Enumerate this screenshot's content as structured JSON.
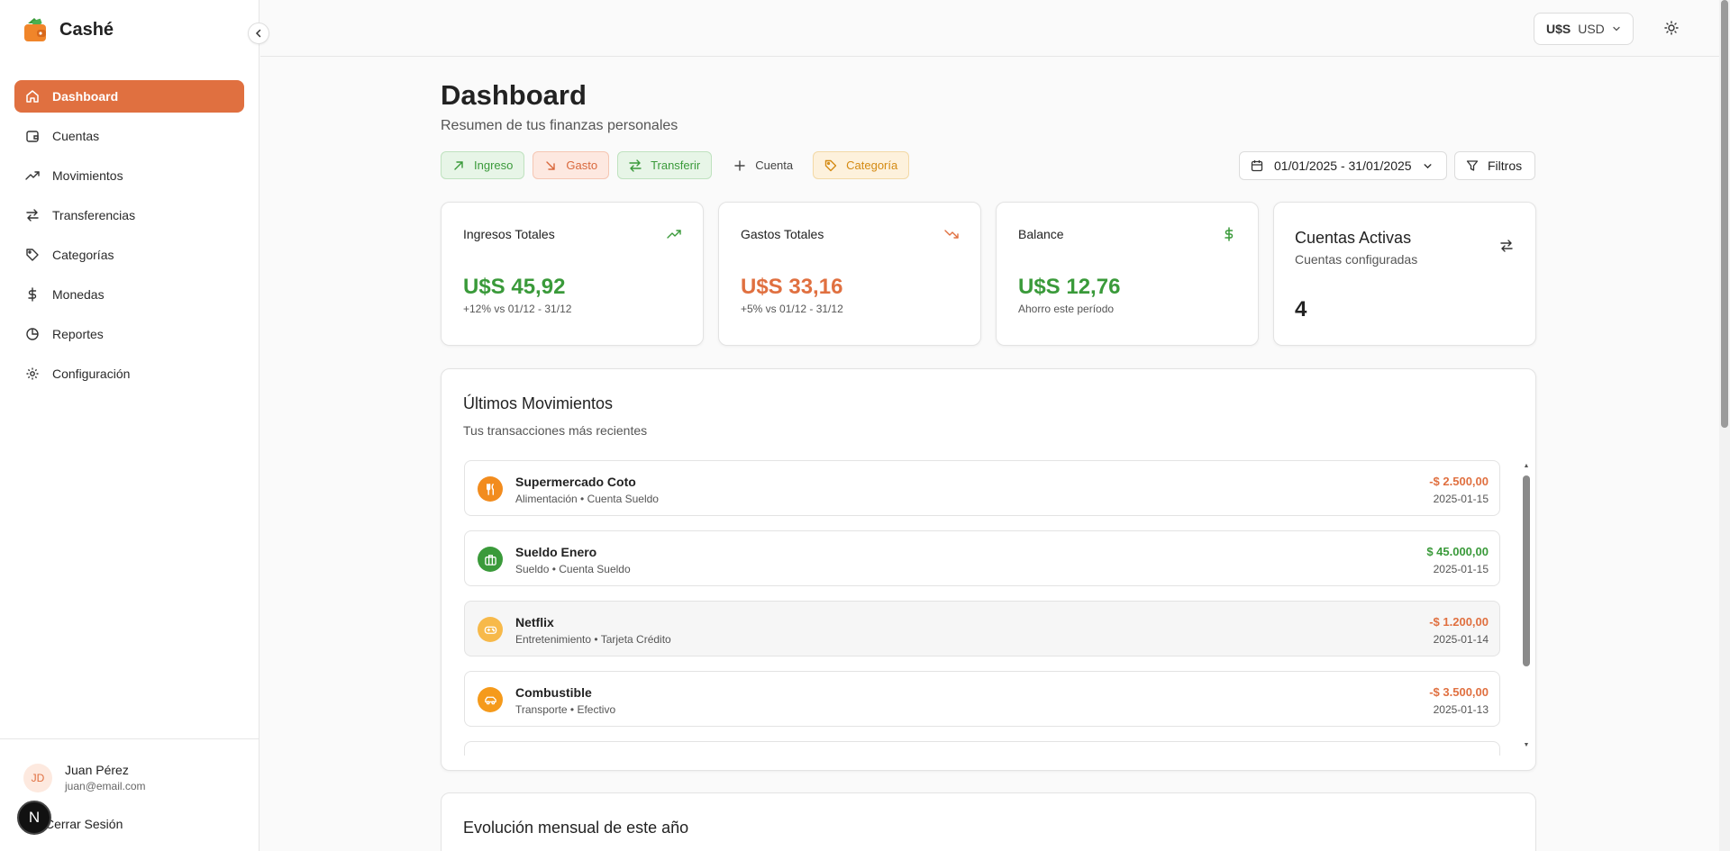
{
  "brand": {
    "name": "Cashé"
  },
  "sidebar": {
    "items": [
      {
        "label": "Dashboard",
        "icon": "home-icon"
      },
      {
        "label": "Cuentas",
        "icon": "wallet-icon"
      },
      {
        "label": "Movimientos",
        "icon": "trending-up-icon"
      },
      {
        "label": "Transferencias",
        "icon": "transfer-icon"
      },
      {
        "label": "Categorías",
        "icon": "tag-icon"
      },
      {
        "label": "Monedas",
        "icon": "dollar-icon"
      },
      {
        "label": "Reportes",
        "icon": "pie-chart-icon"
      },
      {
        "label": "Configuración",
        "icon": "gear-icon"
      }
    ],
    "active_index": 0
  },
  "user": {
    "initials": "JD",
    "name": "Juan Pérez",
    "email": "juan@email.com",
    "logout_label": "Cerrar Sesión"
  },
  "floating_badge": "N",
  "topbar": {
    "currency_symbol": "U$S",
    "currency_code": "USD"
  },
  "header": {
    "title": "Dashboard",
    "subtitle": "Resumen de tus finanzas personales"
  },
  "actions": {
    "ingreso": "Ingreso",
    "gasto": "Gasto",
    "transferir": "Transferir",
    "cuenta": "Cuenta",
    "categoria": "Categoría"
  },
  "date_range": "01/01/2025 - 31/01/2025",
  "filters_label": "Filtros",
  "stats": {
    "ingresos": {
      "label": "Ingresos Totales",
      "value": "U$S 45,92",
      "note": "+12% vs 01/12 - 31/12"
    },
    "gastos": {
      "label": "Gastos Totales",
      "value": "U$S 33,16",
      "note": "+5% vs 01/12 - 31/12"
    },
    "balance": {
      "label": "Balance",
      "value": "U$S 12,76",
      "note": "Ahorro este período"
    },
    "cuentas": {
      "title": "Cuentas Activas",
      "subtitle": "Cuentas configuradas",
      "count": "4"
    }
  },
  "movements": {
    "title": "Últimos Movimientos",
    "subtitle": "Tus transacciones más recientes",
    "items": [
      {
        "name": "Supermercado Coto",
        "meta": "Alimentación • Cuenta Sueldo",
        "amount": "-$ 2.500,00",
        "date": "2025-01-15",
        "type": "expense",
        "icon": "utensils-icon",
        "icon_color": "#f28c1e"
      },
      {
        "name": "Sueldo Enero",
        "meta": "Sueldo • Cuenta Sueldo",
        "amount": "$ 45.000,00",
        "date": "2025-01-15",
        "type": "income",
        "icon": "briefcase-icon",
        "icon_color": "#3a9a3a"
      },
      {
        "name": "Netflix",
        "meta": "Entretenimiento • Tarjeta Crédito",
        "amount": "-$ 1.200,00",
        "date": "2025-01-14",
        "type": "expense",
        "icon": "gamepad-icon",
        "icon_color": "#f7b94a"
      },
      {
        "name": "Combustible",
        "meta": "Transporte • Efectivo",
        "amount": "-$ 3.500,00",
        "date": "2025-01-13",
        "type": "expense",
        "icon": "car-icon",
        "icon_color": "#f59a1b"
      }
    ]
  },
  "evolution": {
    "title": "Evolución mensual de este año"
  },
  "colors": {
    "accent": "#e07040",
    "income": "#3a9a3a",
    "expense": "#e07040",
    "category": "#d48a12"
  }
}
